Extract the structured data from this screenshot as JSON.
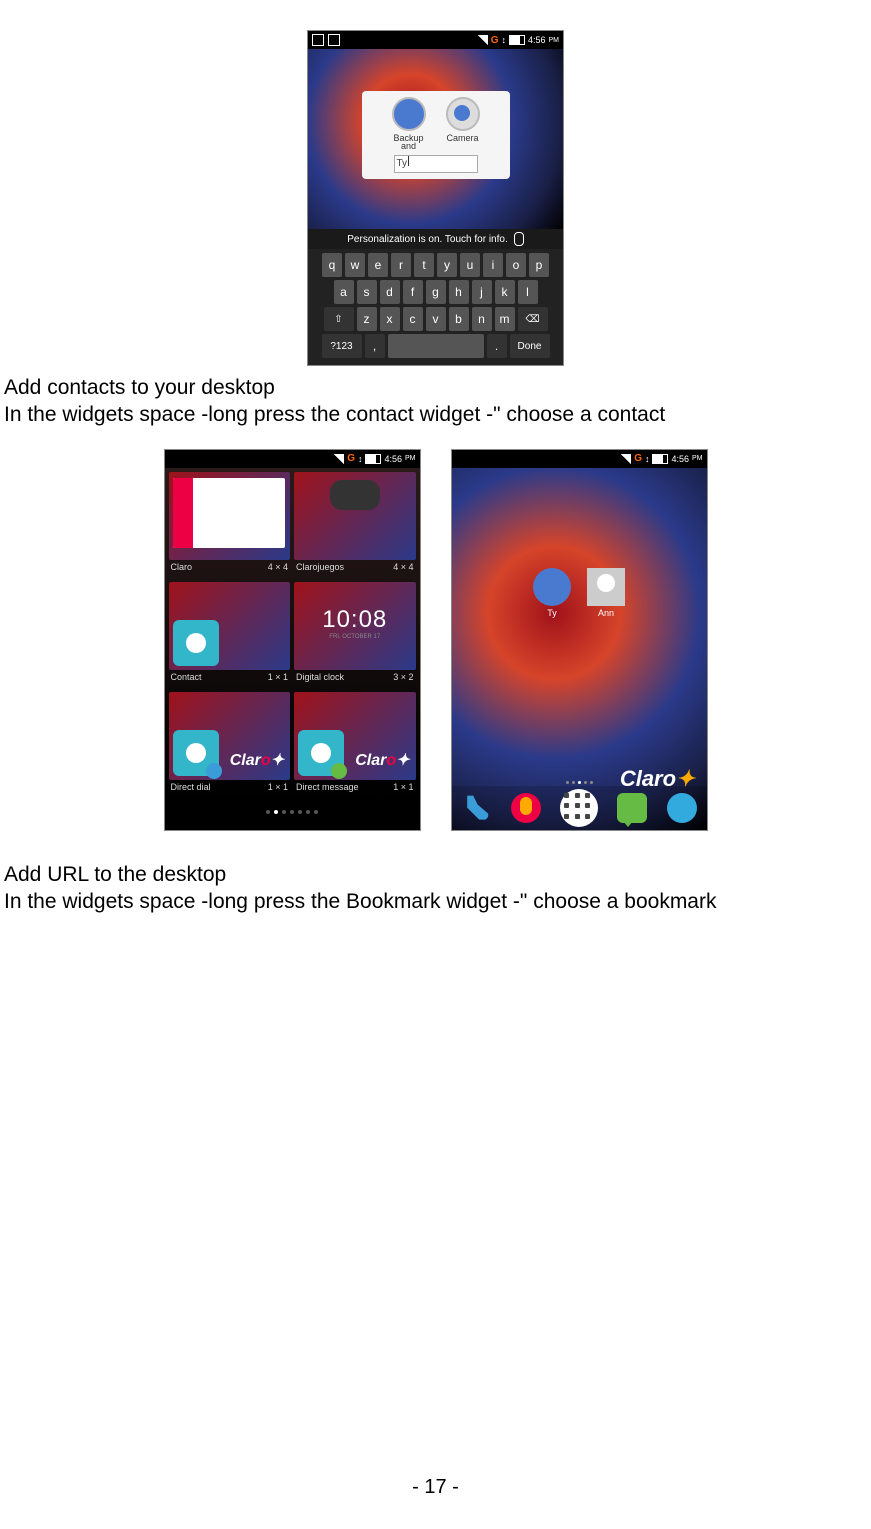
{
  "status": {
    "network_label": "G",
    "arrows": "↕",
    "time": "4:56",
    "ampm": "PM"
  },
  "ss1": {
    "popup": {
      "icon1": "Backup",
      "icon1b": "and",
      "icon2": "Camera",
      "typed": "Ty"
    },
    "hint": "Personalization is on. Touch for info.",
    "rows": {
      "r1": [
        "q",
        "w",
        "e",
        "r",
        "t",
        "y",
        "u",
        "i",
        "o",
        "p"
      ],
      "r2": [
        "a",
        "s",
        "d",
        "f",
        "g",
        "h",
        "j",
        "k",
        "l"
      ],
      "r3": {
        "shift": "⇧",
        "keys": [
          "z",
          "x",
          "c",
          "v",
          "b",
          "n",
          "m"
        ],
        "del": "⌫"
      },
      "r4": {
        "sym": "?123",
        "comma": ",",
        "dot": ".",
        "done": "Done"
      }
    }
  },
  "ss2": {
    "widgets": [
      {
        "name": "Claro",
        "size": "4 × 4"
      },
      {
        "name": "Clarojuegos",
        "size": "4 × 4"
      },
      {
        "name": "Contact",
        "size": "1 × 1"
      },
      {
        "name": "Digital clock",
        "size": "3 × 2",
        "clock": "10:08",
        "clock_sub": "FRI, OCTOBER 17"
      },
      {
        "name": "Direct dial",
        "size": "1 × 1"
      },
      {
        "name": "Direct message",
        "size": "1 × 1"
      }
    ],
    "claro_text": "Clar"
  },
  "ss3": {
    "shortcuts": [
      {
        "label": "Ty"
      },
      {
        "label": "Ann"
      }
    ],
    "brand": "Claro"
  },
  "captions": {
    "c1a": "Add contacts to your desktop",
    "c1b": "In the widgets space -long press the contact widget -\" choose a contact",
    "c2a": "Add URL to the desktop",
    "c2b": "In the widgets space -long press the Bookmark widget -\" choose a bookmark"
  },
  "page_number": "- 17 -"
}
